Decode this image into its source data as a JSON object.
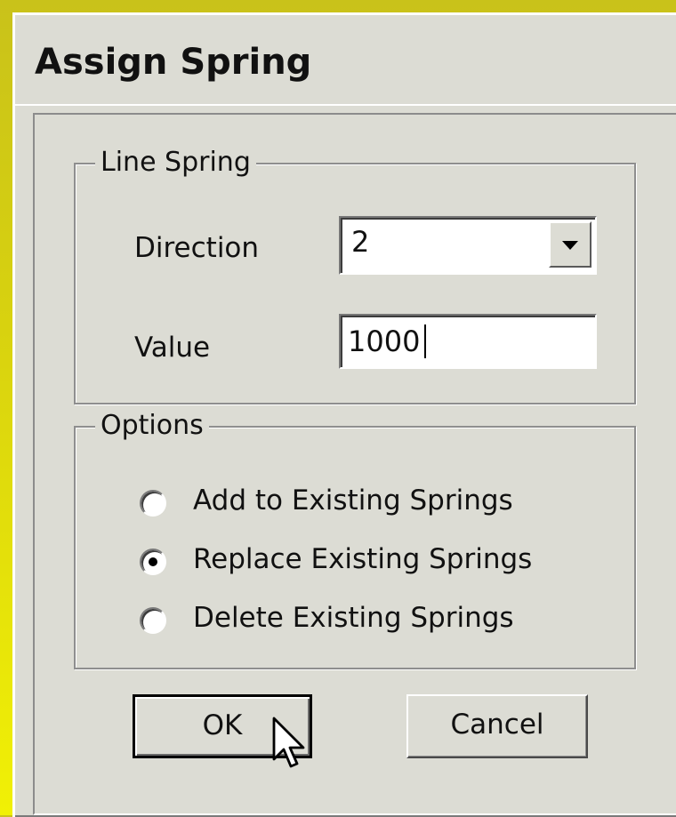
{
  "dialog": {
    "title": "Assign Spring"
  },
  "line_spring": {
    "legend": "Line Spring",
    "direction_label": "Direction",
    "direction_value": "2",
    "value_label": "Value",
    "value_text": "1000"
  },
  "options": {
    "legend": "Options",
    "items": [
      {
        "label": "Add to Existing Springs",
        "selected": false
      },
      {
        "label": "Replace Existing Springs",
        "selected": true
      },
      {
        "label": "Delete Existing Springs",
        "selected": false
      }
    ]
  },
  "buttons": {
    "ok_label": "OK",
    "cancel_label": "Cancel"
  },
  "colors": {
    "background": "#f1f005",
    "dialog_face": "#dcdcd4"
  },
  "icons": {
    "dropdown": "chevron-down-icon",
    "cursor": "mouse-pointer-icon"
  }
}
